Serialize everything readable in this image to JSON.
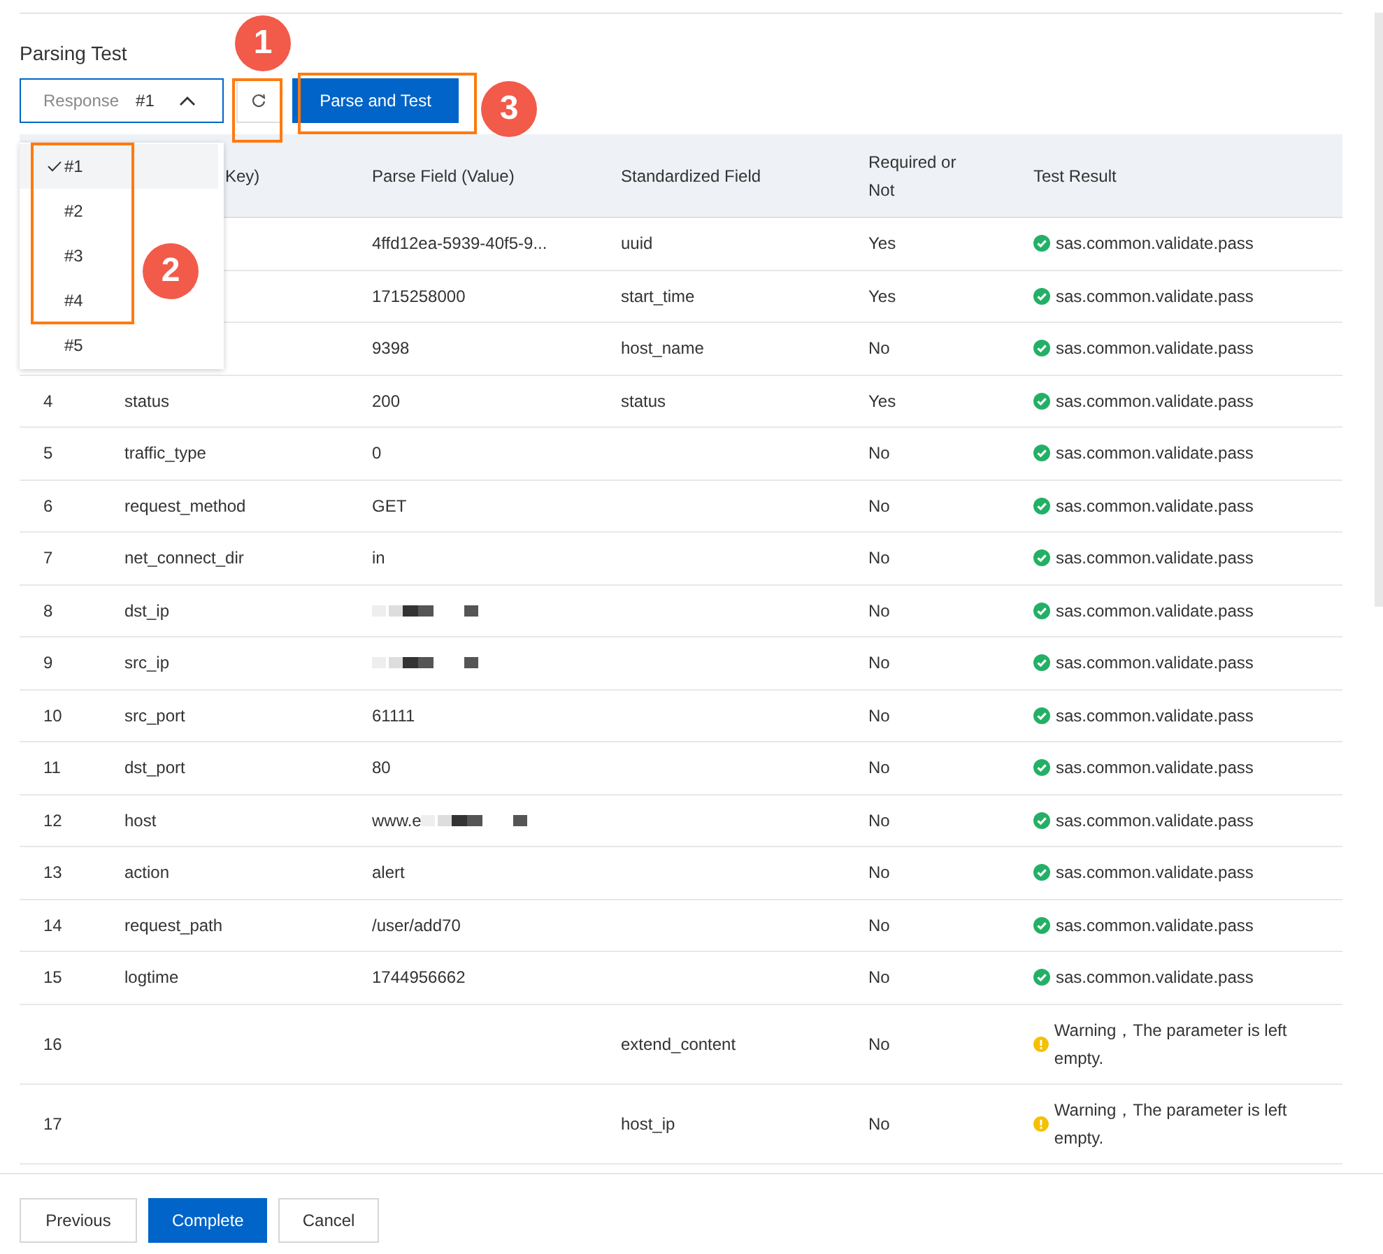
{
  "section_title": "Parsing Test",
  "response_select": {
    "label": "Response",
    "value": "#1",
    "expanded": true
  },
  "response_options": [
    {
      "label": "#1",
      "selected": true
    },
    {
      "label": "#2",
      "selected": false
    },
    {
      "label": "#3",
      "selected": false
    },
    {
      "label": "#4",
      "selected": false
    },
    {
      "label": "#5",
      "selected": false
    }
  ],
  "parse_button": "Parse and Test",
  "table": {
    "columns": [
      "Key)",
      "Parse Field (Value)",
      "Standardized Field",
      "Required or Not",
      "Test Result"
    ],
    "rows": [
      {
        "value": "4ffd12ea-5939-40f5-9...",
        "standard": "uuid",
        "required": "Yes",
        "result": {
          "kind": "pass",
          "text": "sas.common.validate.pass"
        }
      },
      {
        "value": "1715258000",
        "standard": "start_time",
        "required": "Yes",
        "result": {
          "kind": "pass",
          "text": "sas.common.validate.pass"
        }
      },
      {
        "value": "9398",
        "standard": "host_name",
        "required": "No",
        "result": {
          "kind": "pass",
          "text": "sas.common.validate.pass"
        }
      },
      {
        "index": "4",
        "key": "status",
        "value": "200",
        "standard": "status",
        "required": "Yes",
        "result": {
          "kind": "pass",
          "text": "sas.common.validate.pass"
        }
      },
      {
        "index": "5",
        "key": "traffic_type",
        "value": "0",
        "required": "No",
        "result": {
          "kind": "pass",
          "text": "sas.common.validate.pass"
        }
      },
      {
        "index": "6",
        "key": "request_method",
        "value": "GET",
        "required": "No",
        "result": {
          "kind": "pass",
          "text": "sas.common.validate.pass"
        }
      },
      {
        "index": "7",
        "key": "net_connect_dir",
        "value": "in",
        "required": "No",
        "result": {
          "kind": "pass",
          "text": "sas.common.validate.pass"
        }
      },
      {
        "index": "8",
        "key": "dst_ip",
        "redacted": true,
        "required": "No",
        "result": {
          "kind": "pass",
          "text": "sas.common.validate.pass"
        }
      },
      {
        "index": "9",
        "key": "src_ip",
        "redacted": true,
        "required": "No",
        "result": {
          "kind": "pass",
          "text": "sas.common.validate.pass"
        }
      },
      {
        "index": "10",
        "key": "src_port",
        "value": "61111",
        "required": "No",
        "result": {
          "kind": "pass",
          "text": "sas.common.validate.pass"
        }
      },
      {
        "index": "11",
        "key": "dst_port",
        "value": "80",
        "required": "No",
        "result": {
          "kind": "pass",
          "text": "sas.common.validate.pass"
        }
      },
      {
        "index": "12",
        "key": "host",
        "value": "www.e",
        "redacted": true,
        "required": "No",
        "result": {
          "kind": "pass",
          "text": "sas.common.validate.pass"
        }
      },
      {
        "index": "13",
        "key": "action",
        "value": "alert",
        "required": "No",
        "result": {
          "kind": "pass",
          "text": "sas.common.validate.pass"
        }
      },
      {
        "index": "14",
        "key": "request_path",
        "value": "/user/add70",
        "required": "No",
        "result": {
          "kind": "pass",
          "text": "sas.common.validate.pass"
        }
      },
      {
        "index": "15",
        "key": "logtime",
        "value": "1744956662",
        "required": "No",
        "result": {
          "kind": "pass",
          "text": "sas.common.validate.pass"
        }
      },
      {
        "index": "16",
        "standard": "extend_content",
        "required": "No",
        "result": {
          "kind": "warning",
          "text": "Warning，The parameter is left empty."
        }
      },
      {
        "index": "17",
        "standard": "host_ip",
        "required": "No",
        "result": {
          "kind": "warning",
          "text": "Warning，The parameter is left empty."
        }
      }
    ]
  },
  "footer_buttons": [
    {
      "label": "Previous",
      "kind": "default"
    },
    {
      "label": "Complete",
      "kind": "primary"
    },
    {
      "label": "Cancel",
      "kind": "default"
    }
  ],
  "annotations": [
    {
      "label": "1"
    },
    {
      "label": "2"
    },
    {
      "label": "3"
    }
  ]
}
